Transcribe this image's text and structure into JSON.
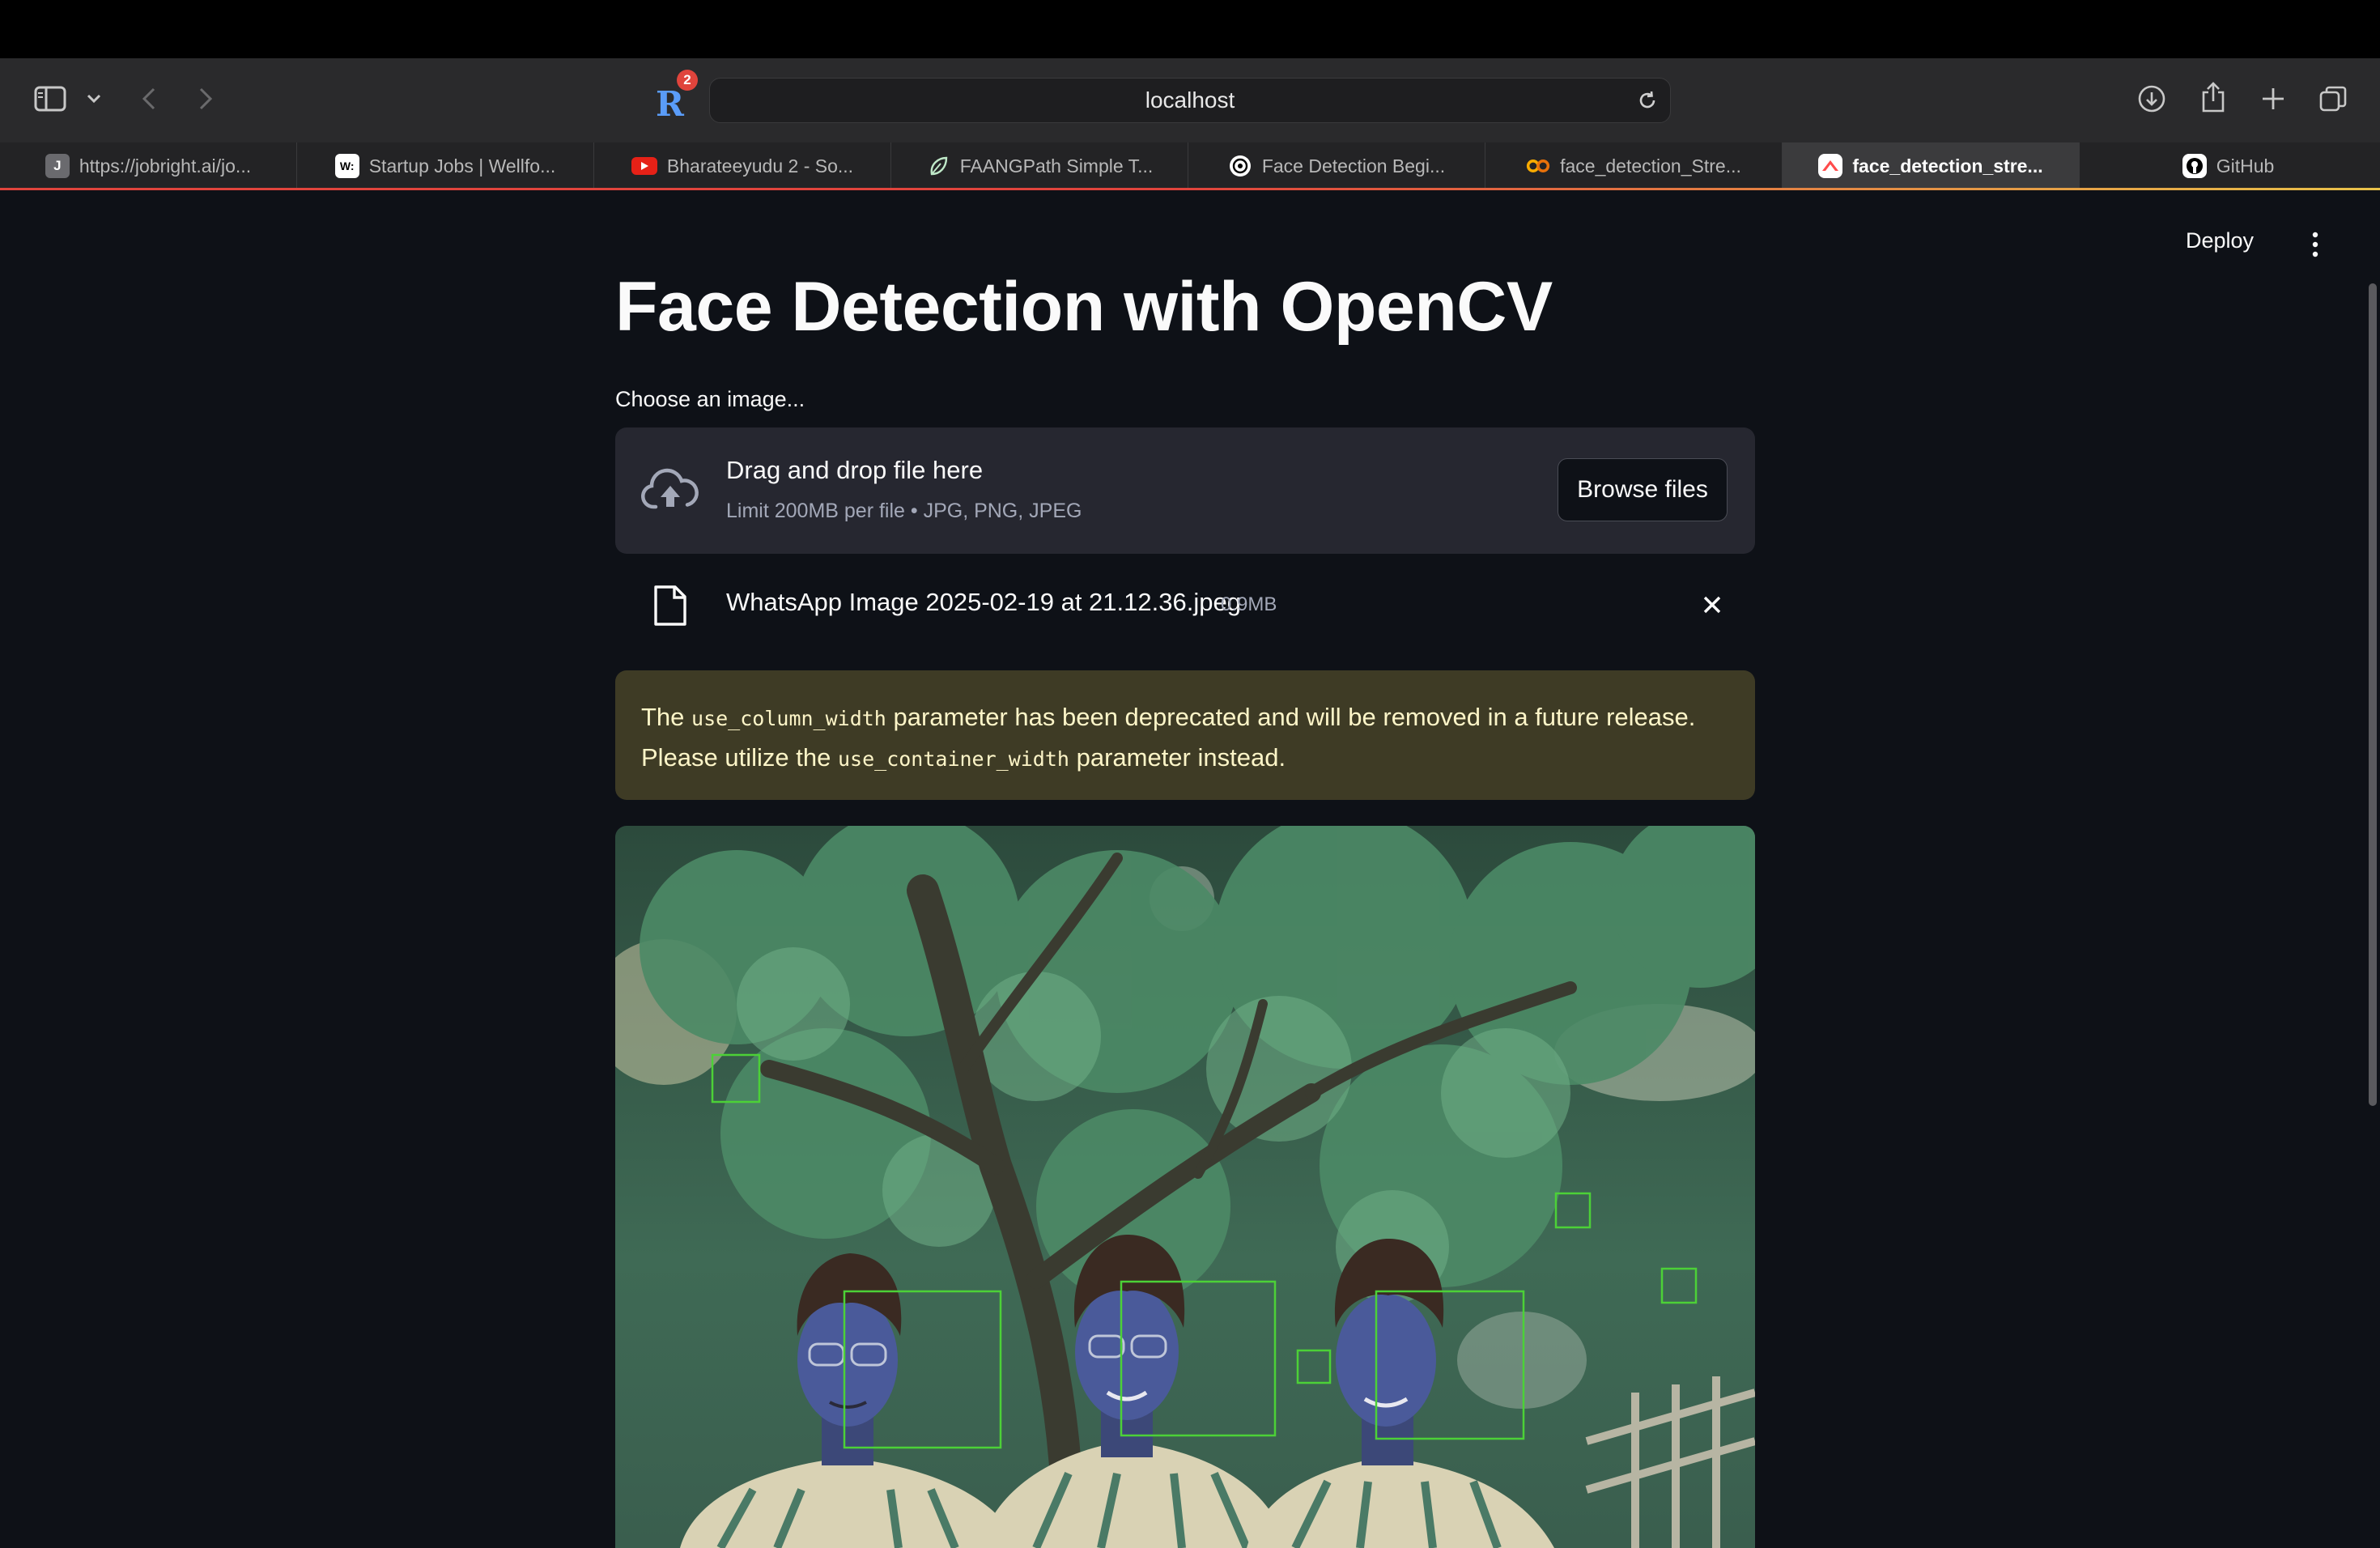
{
  "browser": {
    "url": "localhost",
    "extension_badge": "2",
    "tabs": [
      {
        "label": "https://jobright.ai/jo...",
        "favicon": "J",
        "active": false
      },
      {
        "label": "Startup Jobs | Wellfo...",
        "favicon": "W:",
        "active": false
      },
      {
        "label": "Bharateeyudu 2 - So...",
        "favicon": "youtube-icon",
        "active": false
      },
      {
        "label": "FAANGPath Simple T...",
        "favicon": "leaf-icon",
        "active": false
      },
      {
        "label": "Face Detection Begi...",
        "favicon": "openai-icon",
        "active": false
      },
      {
        "label": "face_detection_Stre...",
        "favicon": "colab-icon",
        "active": false
      },
      {
        "label": "face_detection_stre...",
        "favicon": "streamlit-icon",
        "active": true
      },
      {
        "label": "GitHub",
        "favicon": "github-icon",
        "active": false
      }
    ]
  },
  "app": {
    "deploy_label": "Deploy",
    "title": "Face Detection with OpenCV",
    "uploader_label": "Choose an image...",
    "dropzone_title": "Drag and drop file here",
    "dropzone_subtitle": "Limit 200MB per file • JPG, PNG, JPEG",
    "browse_label": "Browse files",
    "uploaded_file": {
      "name": "WhatsApp Image 2025-02-19 at 21.12.36.jpeg",
      "size": "0.9MB"
    },
    "warning": {
      "text_1": "The ",
      "code_1": "use_column_width",
      "text_2": " parameter has been deprecated and will be removed in a future release. Please utilize the ",
      "code_2": "use_container_width",
      "text_3": " parameter instead."
    }
  },
  "colors": {
    "page_bg": "#0e1117",
    "dropzone_bg": "#262730",
    "warning_bg": "#3e3b25",
    "detection_box": "#4cd137"
  }
}
